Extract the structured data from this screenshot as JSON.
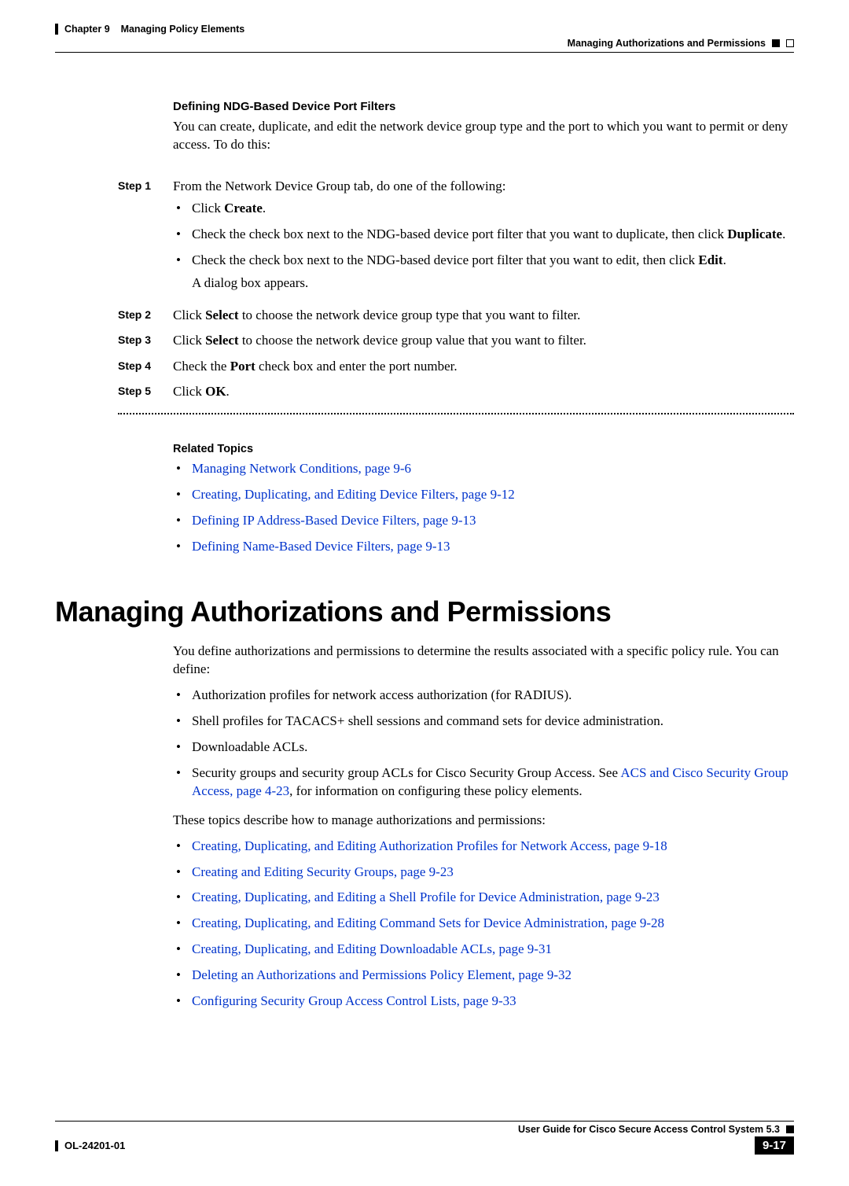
{
  "header": {
    "chapter": "Chapter 9",
    "chapterTitle": "Managing Policy Elements",
    "sectionRight": "Managing Authorizations and Permissions"
  },
  "sec1": {
    "title": "Defining NDG-Based Device Port Filters",
    "intro": "You can create, duplicate, and edit the network device group type and the port to which you want to permit or deny access. To do this:"
  },
  "steps": [
    {
      "label": "Step 1",
      "lead": "From the Network Device Group tab, do one of the following:",
      "bullets": [
        {
          "pre": "Click ",
          "bold": "Create",
          "post": "."
        },
        {
          "pre": "Check the check box next to the NDG-based device port filter that you want to duplicate, then click ",
          "bold": "Duplicate",
          "post": "."
        },
        {
          "pre": "Check the check box next to the NDG-based device port filter that you want to edit, then click ",
          "bold": "Edit",
          "post": "."
        }
      ],
      "trail": "A dialog box appears."
    },
    {
      "label": "Step 2",
      "pre": "Click ",
      "bold": "Select",
      "post": " to choose the network device group type that you want to filter."
    },
    {
      "label": "Step 3",
      "pre": "Click ",
      "bold": "Select",
      "post": " to choose the network device group value that you want to filter."
    },
    {
      "label": "Step 4",
      "pre": "Check the ",
      "bold": "Port",
      "post": " check box and enter the port number."
    },
    {
      "label": "Step 5",
      "pre": "Click ",
      "bold": "OK",
      "post": "."
    }
  ],
  "related": {
    "title": "Related Topics",
    "items": [
      "Managing Network Conditions, page 9-6",
      "Creating, Duplicating, and Editing Device Filters, page 9-12",
      "Defining IP Address-Based Device Filters, page 9-13",
      "Defining Name-Based Device Filters, page 9-13"
    ]
  },
  "h1": "Managing Authorizations and Permissions",
  "para1": "You define authorizations and permissions to determine the results associated with a specific policy rule. You can define:",
  "defineList": [
    {
      "text": "Authorization profiles for network access authorization (for RADIUS)."
    },
    {
      "text": "Shell profiles for TACACS+ shell sessions and command sets for device administration."
    },
    {
      "text": "Downloadable ACLs."
    },
    {
      "pre": "Security groups and security group ACLs for Cisco Security Group Access. See ",
      "link": "ACS and Cisco Security Group Access, page 4-23",
      "post": ", for information on configuring these policy elements."
    }
  ],
  "para2": "These topics describe how to manage authorizations and permissions:",
  "topicLinks": [
    "Creating, Duplicating, and Editing Authorization Profiles for Network Access, page 9-18",
    "Creating and Editing Security Groups, page 9-23",
    "Creating, Duplicating, and Editing a Shell Profile for Device Administration, page 9-23",
    "Creating, Duplicating, and Editing Command Sets for Device Administration, page 9-28",
    "Creating, Duplicating, and Editing Downloadable ACLs, page 9-31",
    "Deleting an Authorizations and Permissions Policy Element, page 9-32",
    "Configuring Security Group Access Control Lists, page 9-33"
  ],
  "footer": {
    "guide": "User Guide for Cisco Secure Access Control System 5.3",
    "docnum": "OL-24201-01",
    "page": "9-17"
  }
}
